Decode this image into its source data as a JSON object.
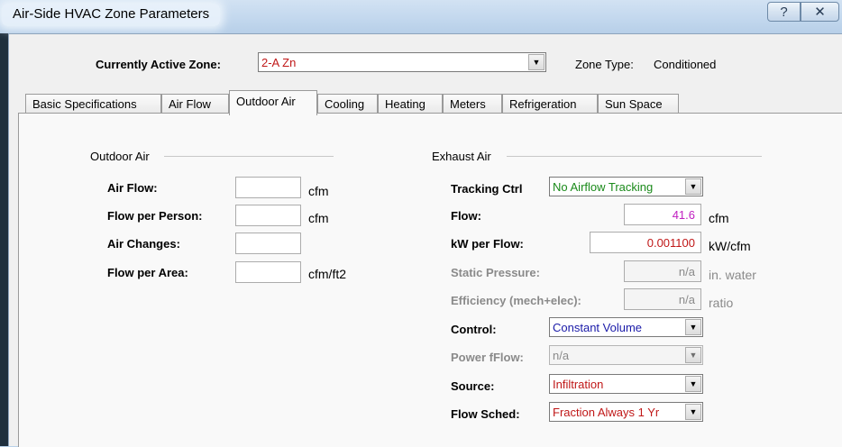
{
  "window": {
    "title": "Air-Side HVAC Zone Parameters",
    "help_glyph": "?",
    "close_glyph": "✕"
  },
  "zone": {
    "label": "Currently Active Zone:",
    "value": "2-A Zn",
    "type_label": "Zone Type:",
    "type_value": "Conditioned"
  },
  "tabs": [
    {
      "label": "Basic Specifications",
      "active": false
    },
    {
      "label": "Air Flow",
      "active": false
    },
    {
      "label": "Outdoor Air",
      "active": true
    },
    {
      "label": "Cooling",
      "active": false
    },
    {
      "label": "Heating",
      "active": false
    },
    {
      "label": "Meters",
      "active": false
    },
    {
      "label": "Refrigeration",
      "active": false
    },
    {
      "label": "Sun Space",
      "active": false
    }
  ],
  "outdoor_air": {
    "heading": "Outdoor Air",
    "air_flow": {
      "label": "Air Flow:",
      "value": "",
      "unit": "cfm"
    },
    "flow_per_person": {
      "label": "Flow per Person:",
      "value": "",
      "unit": "cfm"
    },
    "air_changes": {
      "label": "Air Changes:",
      "value": "",
      "unit": ""
    },
    "flow_per_area": {
      "label": "Flow per Area:",
      "value": "",
      "unit": "cfm/ft2"
    }
  },
  "exhaust_air": {
    "heading": "Exhaust Air",
    "tracking_ctrl": {
      "label": "Tracking Ctrl",
      "value": "No Airflow Tracking",
      "color": "#1a8a1a"
    },
    "flow": {
      "label": "Flow:",
      "value": "41.6",
      "unit": "cfm",
      "color": "#c020c0"
    },
    "kw_per_flow": {
      "label": "kW per Flow:",
      "value": "0.001100",
      "unit": "kW/cfm",
      "color": "#c01818"
    },
    "static_pressure": {
      "label": "Static Pressure:",
      "value": "n/a",
      "unit": "in. water"
    },
    "efficiency": {
      "label": "Efficiency (mech+elec):",
      "value": "n/a",
      "unit": "ratio"
    },
    "control": {
      "label": "Control:",
      "value": "Constant Volume",
      "color": "#1a1aa8"
    },
    "power_fflow": {
      "label": "Power fFlow:",
      "value": "n/a"
    },
    "source": {
      "label": "Source:",
      "value": "Infiltration",
      "color": "#c01818"
    },
    "flow_sched": {
      "label": "Flow Sched:",
      "value": "Fraction Always 1 Yr",
      "color": "#c01818"
    }
  },
  "colors": {
    "zone_value": "#c01818",
    "disabled_text": "#8a8a8a"
  }
}
